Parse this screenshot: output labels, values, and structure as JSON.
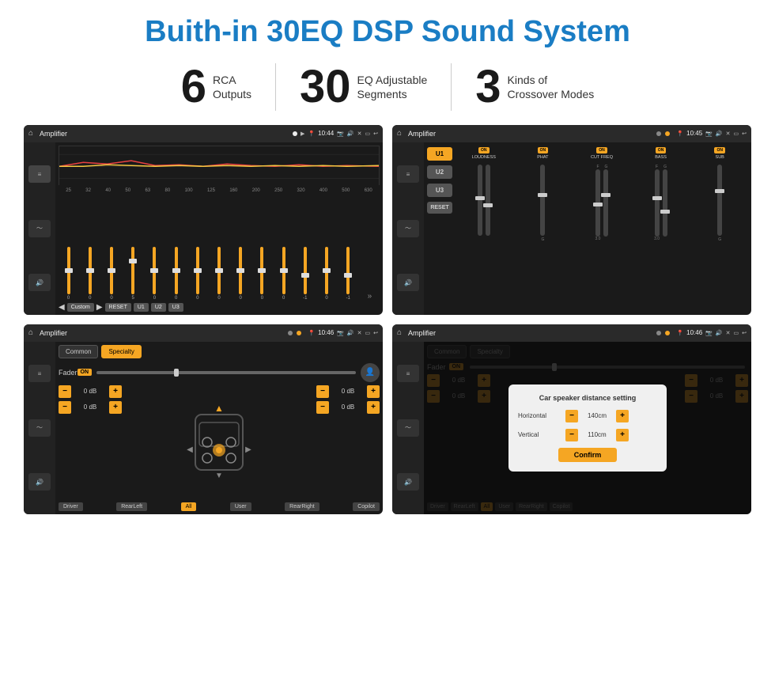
{
  "header": {
    "title": "Buith-in 30EQ DSP Sound System"
  },
  "stats": [
    {
      "number": "6",
      "line1": "RCA",
      "line2": "Outputs"
    },
    {
      "number": "30",
      "line1": "EQ Adjustable",
      "line2": "Segments"
    },
    {
      "number": "3",
      "line1": "Kinds of",
      "line2": "Crossover Modes"
    }
  ],
  "screens": {
    "eq": {
      "title": "Amplifier",
      "time": "10:44",
      "frequencies": [
        "25",
        "32",
        "40",
        "50",
        "63",
        "80",
        "100",
        "125",
        "160",
        "200",
        "250",
        "320",
        "400",
        "500",
        "630"
      ],
      "values": [
        "0",
        "0",
        "0",
        "5",
        "0",
        "0",
        "0",
        "0",
        "0",
        "0",
        "0",
        "-1",
        "0",
        "-1"
      ],
      "buttons": [
        "Custom",
        "RESET",
        "U1",
        "U2",
        "U3"
      ]
    },
    "crossover": {
      "title": "Amplifier",
      "time": "10:45",
      "presets": [
        "U1",
        "U2",
        "U3"
      ],
      "controls": [
        "LOUDNESS",
        "PHAT",
        "CUT FREQ",
        "BASS",
        "SUB"
      ]
    },
    "fader": {
      "title": "Amplifier",
      "time": "10:46",
      "tabs": [
        "Common",
        "Specialty"
      ],
      "fader_label": "Fader",
      "on_label": "ON",
      "db_values": [
        "0 dB",
        "0 dB",
        "0 dB",
        "0 dB"
      ],
      "buttons": [
        "Driver",
        "RearLeft",
        "All",
        "User",
        "RearRight",
        "Copilot"
      ]
    },
    "distance": {
      "title": "Amplifier",
      "time": "10:46",
      "tabs": [
        "Common",
        "Specialty"
      ],
      "modal": {
        "title": "Car speaker distance setting",
        "horizontal_label": "Horizontal",
        "horizontal_value": "140cm",
        "vertical_label": "Vertical",
        "vertical_value": "110cm",
        "confirm_label": "Confirm"
      },
      "db_values": [
        "0 dB",
        "0 dB"
      ],
      "buttons": [
        "Driver",
        "RearLeft",
        "All",
        "User",
        "RearRight",
        "Copilot"
      ]
    }
  }
}
